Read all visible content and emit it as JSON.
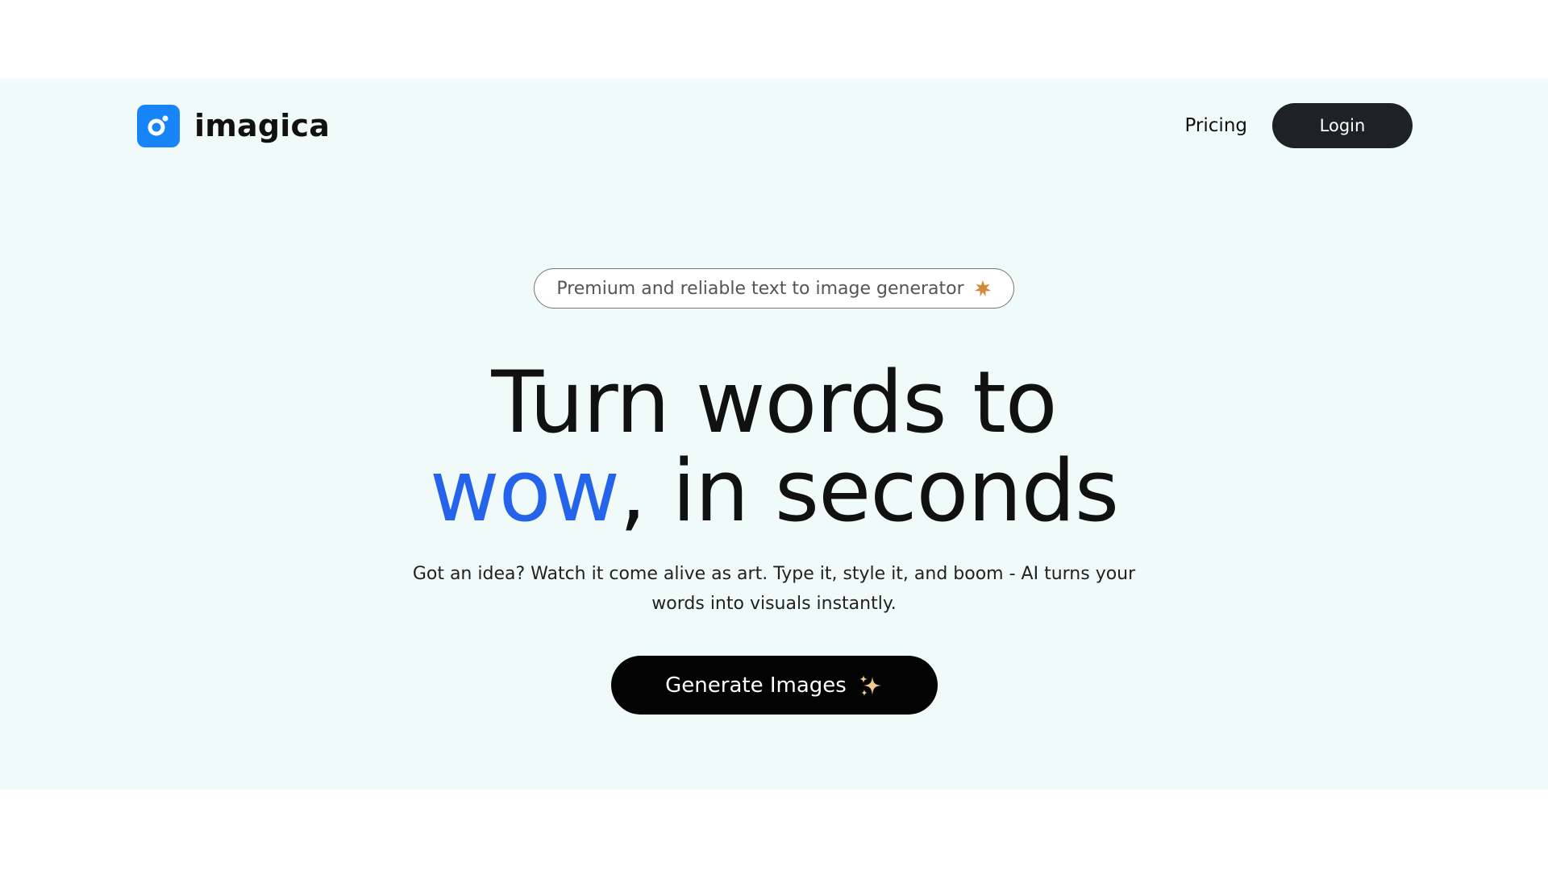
{
  "brand": {
    "name": "imagica",
    "logo_icon": "camera-lens-icon",
    "logo_color": "#1784f7"
  },
  "nav": {
    "pricing_label": "Pricing",
    "login_label": "Login"
  },
  "badge": {
    "text": "Premium and reliable text to image generator",
    "icon": "starburst-icon",
    "icon_color": "#d4883a"
  },
  "hero": {
    "headline_line1": "Turn words to",
    "headline_accent": "wow",
    "headline_rest": ", in seconds",
    "accent_color": "#2563eb",
    "subtitle": "Got an idea? Watch it come alive as art. Type it, style it, and boom - AI turns your words into visuals instantly."
  },
  "cta": {
    "label": "Generate Images",
    "icon": "sparkles-icon",
    "icon_color": "#f2c894"
  },
  "colors": {
    "hero_background": "#f0faf8",
    "button_dark": "#1f2224"
  }
}
